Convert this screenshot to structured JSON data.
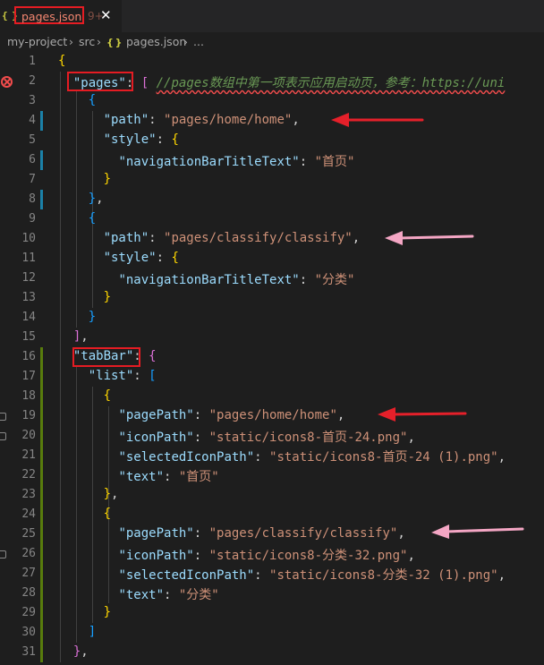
{
  "tab": {
    "icon": "{ }",
    "filename": "pages.json",
    "problem_count": "9+",
    "close": "✕"
  },
  "breadcrumb": {
    "project": "my-project",
    "sep": "›",
    "folder": "src",
    "file_icon": "{ }",
    "file": "pages.json",
    "ellipsis": "..."
  },
  "gutter": {
    "numbers": [
      "1",
      "2",
      "3",
      "4",
      "5",
      "6",
      "7",
      "8",
      "9",
      "10",
      "11",
      "12",
      "13",
      "14",
      "15",
      "16",
      "17",
      "18",
      "19",
      "20",
      "21",
      "22",
      "23",
      "24",
      "25",
      "26",
      "27",
      "28",
      "29",
      "30",
      "31"
    ]
  },
  "code": {
    "pages_key": "\"pages\"",
    "comment": "//pages数组中第一项表示应用启动页，参考：https://uni",
    "path_key": "\"path\"",
    "style_key": "\"style\"",
    "nav_key": "\"navigationBarTitleText\"",
    "home_path": "\"pages/home/home\"",
    "home_title": "\"首页\"",
    "classify_path": "\"pages/classify/classify\"",
    "classify_title": "\"分类\"",
    "tabbar_key": "\"tabBar\"",
    "list_key": "\"list\"",
    "pagepath_key": "\"pagePath\"",
    "iconpath_key": "\"iconPath\"",
    "selected_key": "\"selectedIconPath\"",
    "text_key": "\"text\"",
    "home_icon": "\"static/icons8-首页-24.png\"",
    "home_selected": "\"static/icons8-首页-24 (1).png\"",
    "home_text": "\"首页\"",
    "classify_icon": "\"static/icons8-分类-32.png\"",
    "classify_selected": "\"static/icons8-分类-32 (1).png\"",
    "classify_text": "\"分类\""
  },
  "colors": {
    "annotation_red": "#e51c23",
    "arrow_red": "#e5202a",
    "arrow_pink": "#f4a6c4",
    "modified_blue": "#1b81a8",
    "added_green": "#587c0c"
  }
}
